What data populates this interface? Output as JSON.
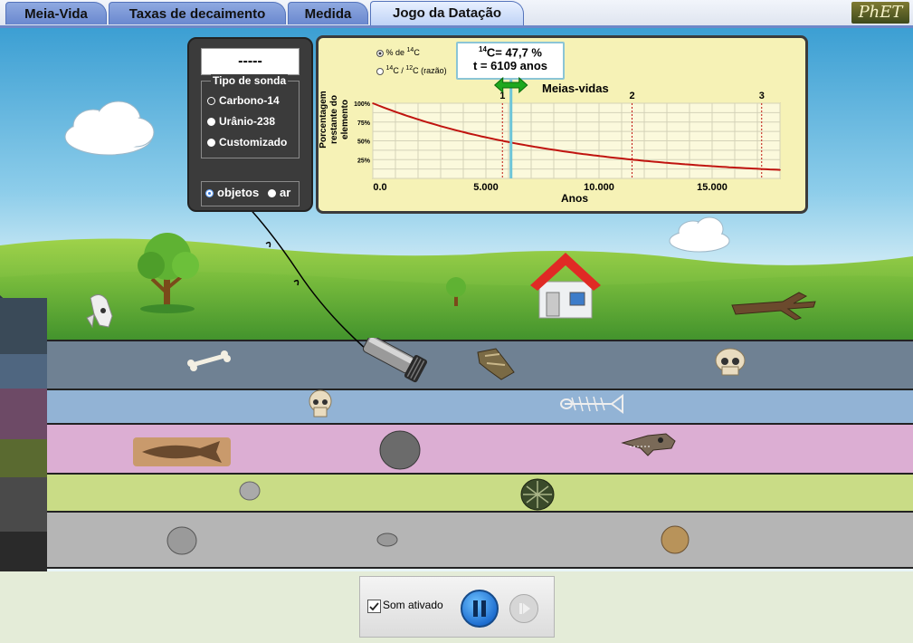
{
  "tabs": [
    {
      "label": "Meia-Vida",
      "active": false
    },
    {
      "label": "Taxas de decaimento",
      "active": false
    },
    {
      "label": "Medida",
      "active": false
    },
    {
      "label": "Jogo da Datação",
      "active": true
    }
  ],
  "logo_text": "PhET",
  "probe_panel": {
    "readout": "-----",
    "group_title": "Tipo de sonda",
    "options": [
      "Carbono-14",
      "Urânio-238",
      "Customizado"
    ],
    "selected_option": "Carbono-14",
    "target_options": [
      "objetos",
      "ar"
    ],
    "selected_target": "objetos"
  },
  "graph": {
    "mode_options": [
      {
        "pre": "% de ",
        "sup": "14",
        "post": "C",
        "selected": true
      },
      {
        "sup1": "14",
        "mid": "C / ",
        "sup2": "12",
        "post": "C (razão)",
        "selected": false
      }
    ],
    "readout": {
      "iso_sup": "14",
      "iso_label": "C= 47,7 %",
      "time_label": "t = 6109 anos"
    },
    "half_lives_label": "Meias-vidas",
    "half_life_markers": [
      "1",
      "2",
      "3"
    ]
  },
  "chart_data": {
    "type": "line",
    "title": "",
    "xlabel": "Anos",
    "ylabel": "Porcentagem restante do elemento",
    "xlim": [
      0,
      18000
    ],
    "ylim": [
      0,
      100
    ],
    "x_ticks": [
      "0.0",
      "5.000",
      "10.000",
      "15.000"
    ],
    "x_tick_values": [
      0,
      5000,
      10000,
      15000
    ],
    "y_ticks": [
      "100%",
      "75%",
      "50%",
      "25%"
    ],
    "y_tick_values": [
      100,
      75,
      50,
      25
    ],
    "half_life_years": 5730,
    "half_life_lines": [
      5730,
      11460,
      17190
    ],
    "cursor_x": 6109,
    "series": [
      {
        "color": "#c0140f",
        "x": [
          0,
          2000,
          4000,
          5730,
          6109,
          8000,
          10000,
          11460,
          12000,
          14000,
          16000,
          17190,
          18000
        ],
        "y": [
          100,
          78.5,
          61.6,
          50,
          47.7,
          38,
          29.8,
          25,
          23.4,
          18.4,
          14.4,
          12.5,
          11.3
        ]
      }
    ],
    "grid": true
  },
  "controls": {
    "sound_label": "Som ativado",
    "sound_checked": true
  },
  "colors": {
    "accent_tab": "#6a88cf",
    "curve": "#c0140f",
    "cursor": "#6cc5d8",
    "marker_green": "#1ea81e"
  }
}
